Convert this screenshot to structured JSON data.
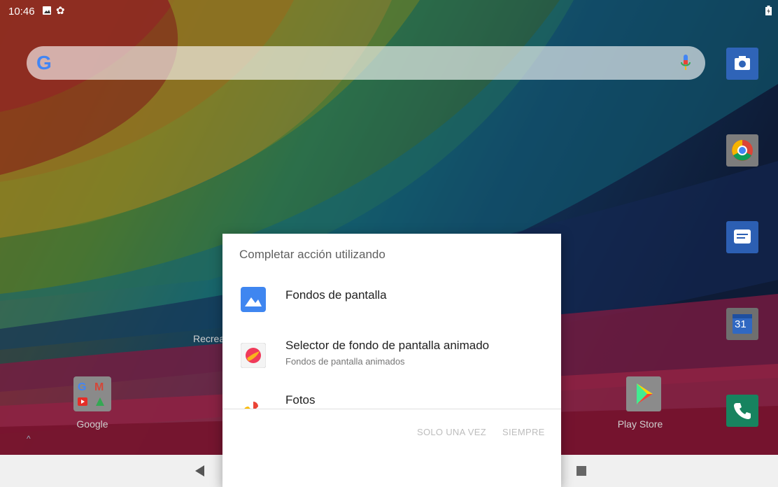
{
  "status_bar": {
    "time": "10:46",
    "icons": [
      "image-icon",
      "settings-gear-icon",
      "battery-icon"
    ]
  },
  "search_bar": {
    "logo": "G",
    "icons": [
      "google-logo",
      "microphone-icon"
    ]
  },
  "dock": {
    "icons": [
      "camera-app-icon",
      "chrome-app-icon",
      "messages-app-icon",
      "calendar-app-icon",
      "phone-app-icon"
    ],
    "calendar_day": "31"
  },
  "home_apps": {
    "folder_google": {
      "label": "Google",
      "letters": [
        "G",
        "M"
      ]
    },
    "folder_recreation": {
      "label": "Recrea"
    },
    "play_store": {
      "label": "Play Store"
    }
  },
  "chooser_dialog": {
    "title": "Completar acción utilizando",
    "options": [
      {
        "name": "Fondos de pantalla",
        "subtitle": "",
        "icon": "wallpapers-icon"
      },
      {
        "name": "Selector de fondo de pantalla animado",
        "subtitle": "Fondos de pantalla animados",
        "icon": "live-wallpaper-picker-icon"
      },
      {
        "name": "Fotos",
        "subtitle": "",
        "icon": "google-photos-icon"
      }
    ],
    "buttons": {
      "once": "SOLO UNA VEZ",
      "always": "SIEMPRE"
    }
  },
  "nav_bar": {
    "icons": [
      "back-icon",
      "home-icon",
      "recents-icon"
    ]
  },
  "colors": {
    "dialog_bg": "#ffffff",
    "dim": "rgba(0,0,0,0.38)",
    "disabled_button": "#bdbdbd"
  }
}
